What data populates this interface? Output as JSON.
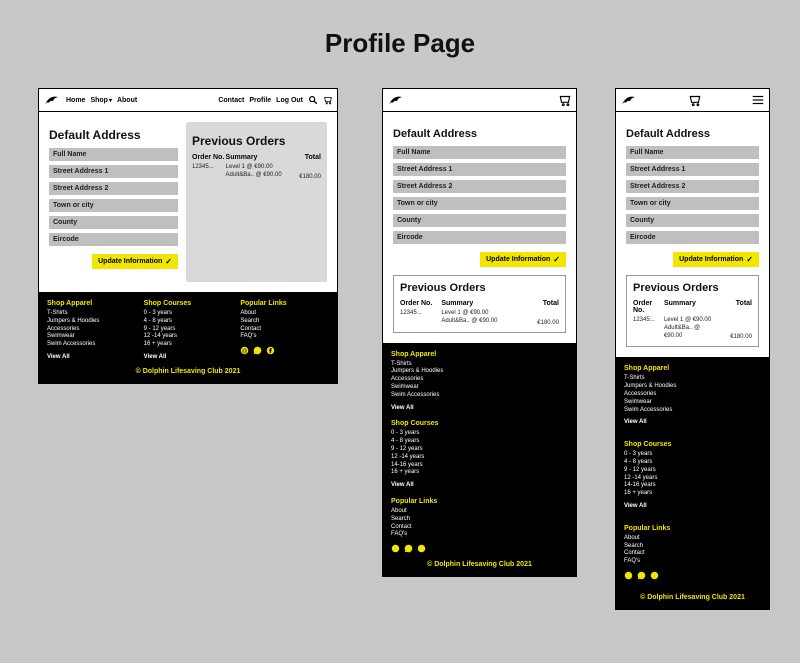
{
  "page": {
    "title": "Profile Page"
  },
  "nav": {
    "home": "Home",
    "shop": "Shop",
    "about": "About",
    "contact": "Contact",
    "profile": "Profile",
    "logout": "Log Out"
  },
  "address": {
    "heading": "Default Address",
    "fields": {
      "fullname": "Full Name",
      "street1": "Street Address 1",
      "street2": "Street Address 2",
      "town": "Town or city",
      "county": "County",
      "eircode": "Eircode"
    },
    "button": "Update Information"
  },
  "orders": {
    "heading": "Previous Orders",
    "cols": {
      "no": "Order No.",
      "summary": "Summary",
      "total": "Total"
    },
    "row": {
      "no": "12345...",
      "line1": "Level 1 @ €90.00",
      "line2": "Adult&Ba.. @ €90.00",
      "total": "€180.00"
    }
  },
  "footer": {
    "apparel": {
      "title": "Shop Apparel",
      "l1": "T-Shirts",
      "l2": "Jumpers & Hoodies",
      "l3": "Accessories",
      "l4": "Swimwear",
      "l5": "Swim Accessories"
    },
    "courses": {
      "title": "Shop Courses",
      "l1": "0 - 3 years",
      "l2": "4 - 8 years",
      "l3": "9 - 12 years",
      "l4": "12 -14 years",
      "l4b": "14-16 years",
      "l5": "16 + years"
    },
    "popular": {
      "title": "Popular Links",
      "l1": "About",
      "l2": "Search",
      "l3": "Contact",
      "l4": "FAQ's"
    },
    "viewall": "View All",
    "copy": "© Dolphin Lifesaving Club 2021"
  }
}
